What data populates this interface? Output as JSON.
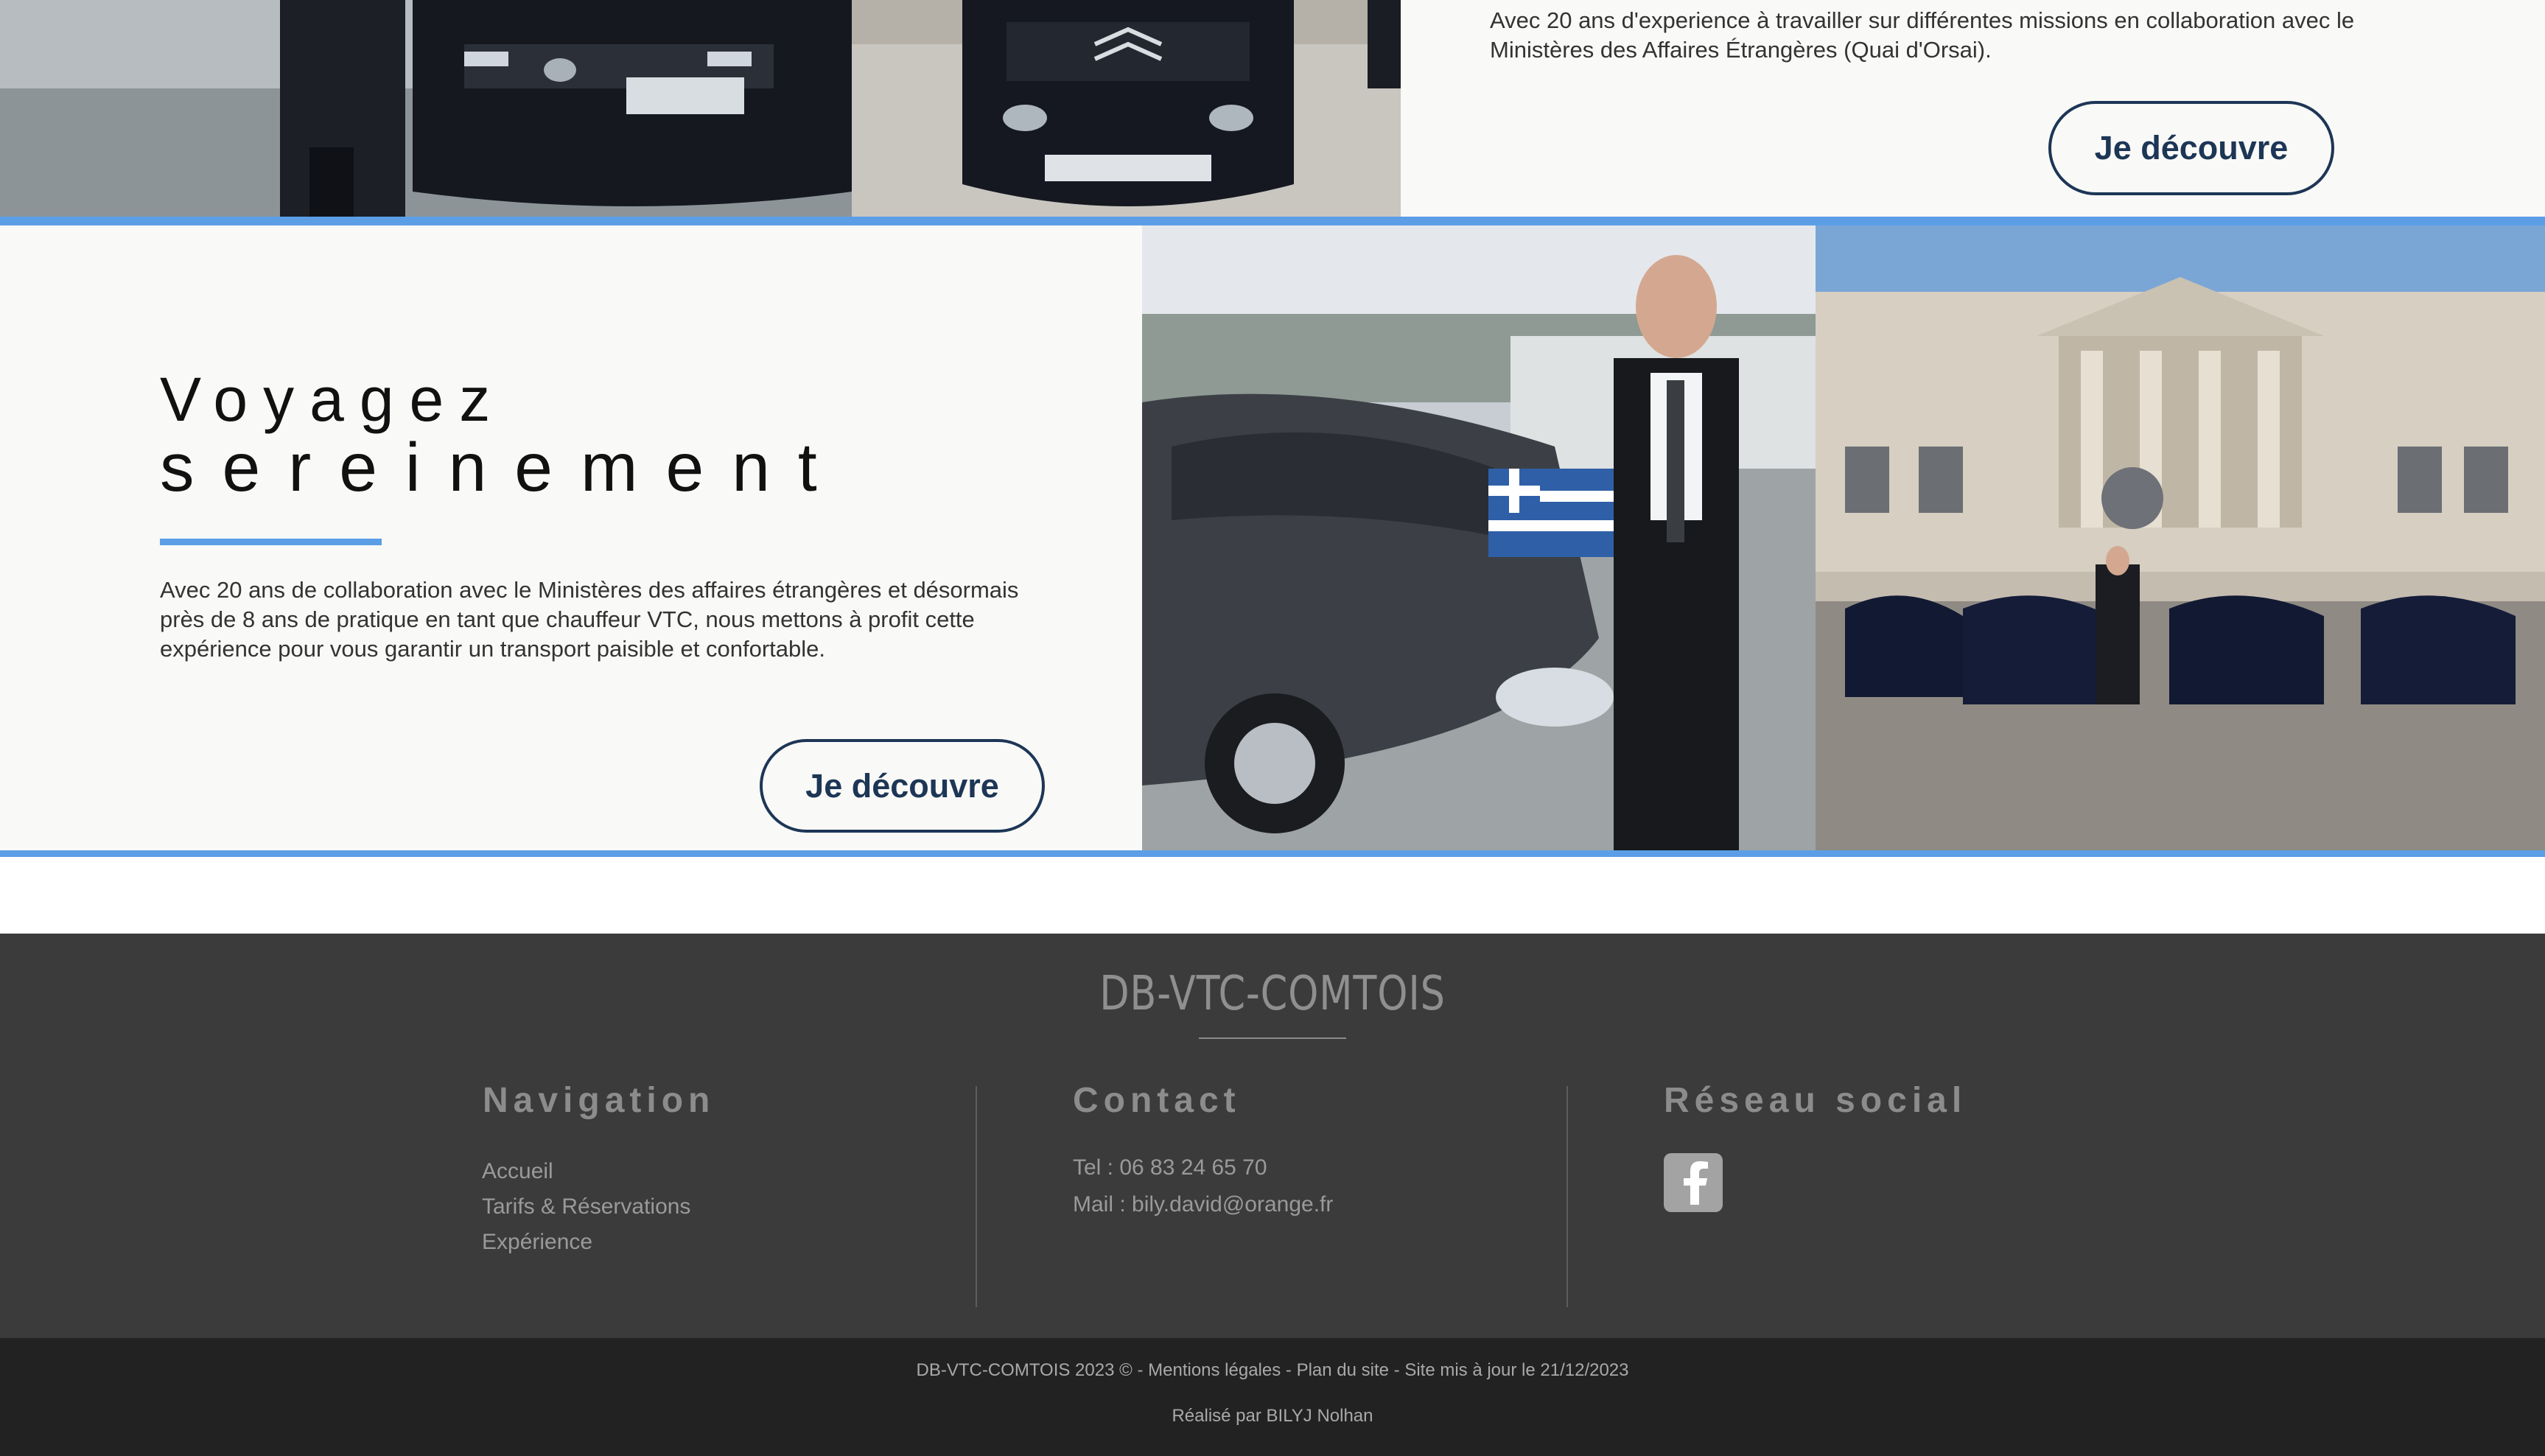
{
  "top_section": {
    "text": "Avec 20 ans d'experience à travailler sur différentes missions en collaboration avec le Ministères des Affaires Étrangères (Quai d'Orsai).",
    "button_label": "Je découvre"
  },
  "mid_section": {
    "title_line1": "Voyagez",
    "title_line2": "sereinement",
    "text": "Avec 20 ans de collaboration avec le Ministères des affaires étrangères et désormais près de 8 ans de pratique en tant que chauffeur VTC, nous mettons à profit cette expérience pour vous garantir un transport paisible et confortable.",
    "button_label": "Je découvre"
  },
  "colors": {
    "accent_blue": "#5c9ee6",
    "button_navy": "#1d3656",
    "footer_bg": "#3b3b3b",
    "bottom_bar_bg": "#222222"
  },
  "footer": {
    "brand": "DB-VTC-COMTOIS",
    "navigation": {
      "heading": "Navigation",
      "links": [
        "Accueil",
        "Tarifs & Réservations",
        "Expérience"
      ]
    },
    "contact": {
      "heading": "Contact",
      "tel": "Tel : 06 83 24 65 70",
      "mail": "Mail : bily.david@orange.fr"
    },
    "social": {
      "heading": "Réseau social",
      "icon": "facebook-icon"
    },
    "legal": {
      "copyright": "DB-VTC-COMTOIS 2023 ©",
      "sep": " - ",
      "mentions": "Mentions légales",
      "sitemap": "Plan du site",
      "updated": "Site mis à jour le 21/12/2023"
    },
    "credit": "Réalisé par BILYJ Nolhan"
  }
}
